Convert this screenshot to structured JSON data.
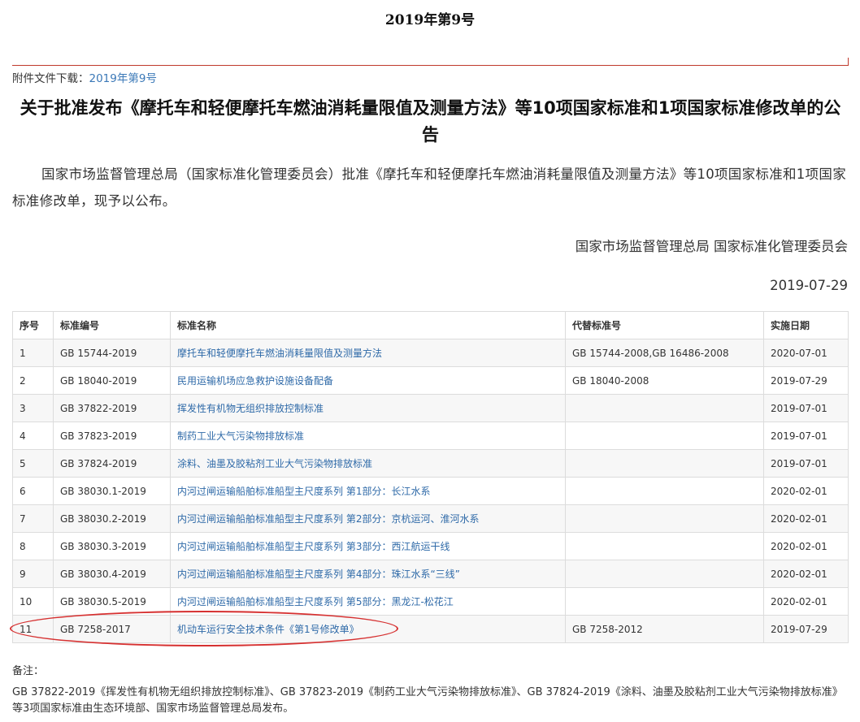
{
  "issue_title": "2019年第9号",
  "attachment": {
    "label": "附件文件下载：",
    "link": "2019年第9号"
  },
  "headline": "关于批准发布《摩托车和轻便摩托车燃油消耗量限值及测量方法》等10项国家标准和1项国家标准修改单的公告",
  "body": "国家市场监督管理总局（国家标准化管理委员会）批准《摩托车和轻便摩托车燃油消耗量限值及测量方法》等10项国家标准和1项国家标准修改单，现予以公布。",
  "signature": "国家市场监督管理总局 国家标准化管理委员会",
  "date": "2019-07-29",
  "table": {
    "headers": [
      "序号",
      "标准编号",
      "标准名称",
      "代替标准号",
      "实施日期"
    ],
    "rows": [
      [
        "1",
        "GB 15744-2019",
        "摩托车和轻便摩托车燃油消耗量限值及测量方法",
        "GB 15744-2008,GB 16486-2008",
        "2020-07-01"
      ],
      [
        "2",
        "GB 18040-2019",
        "民用运输机场应急救护设施设备配备",
        "GB 18040-2008",
        "2019-07-29"
      ],
      [
        "3",
        "GB 37822-2019",
        "挥发性有机物无组织排放控制标准",
        "",
        "2019-07-01"
      ],
      [
        "4",
        "GB 37823-2019",
        "制药工业大气污染物排放标准",
        "",
        "2019-07-01"
      ],
      [
        "5",
        "GB 37824-2019",
        "涂料、油墨及胶粘剂工业大气污染物排放标准",
        "",
        "2019-07-01"
      ],
      [
        "6",
        "GB 38030.1-2019",
        "内河过闸运输船舶标准船型主尺度系列 第1部分：长江水系",
        "",
        "2020-02-01"
      ],
      [
        "7",
        "GB 38030.2-2019",
        "内河过闸运输船舶标准船型主尺度系列 第2部分：京杭运河、淮河水系",
        "",
        "2020-02-01"
      ],
      [
        "8",
        "GB 38030.3-2019",
        "内河过闸运输船舶标准船型主尺度系列 第3部分：西江航运干线",
        "",
        "2020-02-01"
      ],
      [
        "9",
        "GB 38030.4-2019",
        "内河过闸运输船舶标准船型主尺度系列 第4部分：珠江水系“三线”",
        "",
        "2020-02-01"
      ],
      [
        "10",
        "GB 38030.5-2019",
        "内河过闸运输船舶标准船型主尺度系列 第5部分：黑龙江-松花江",
        "",
        "2020-02-01"
      ],
      [
        "11",
        "GB 7258-2017",
        "机动车运行安全技术条件《第1号修改单》",
        "GB 7258-2012",
        "2019-07-29"
      ]
    ]
  },
  "remarks": {
    "title": "备注：",
    "text": "GB 37822-2019《挥发性有机物无组织排放控制标准》、GB 37823-2019《制药工业大气污染物排放标准》、GB 37824-2019《涂料、油墨及胶粘剂工业大气污染物排放标准》等3项国家标准由生态环境部、国家市场监督管理总局发布。"
  },
  "colors": {
    "link": "#2f6aa8",
    "rule": "#c0392b",
    "highlight_oval": "#d63131"
  }
}
